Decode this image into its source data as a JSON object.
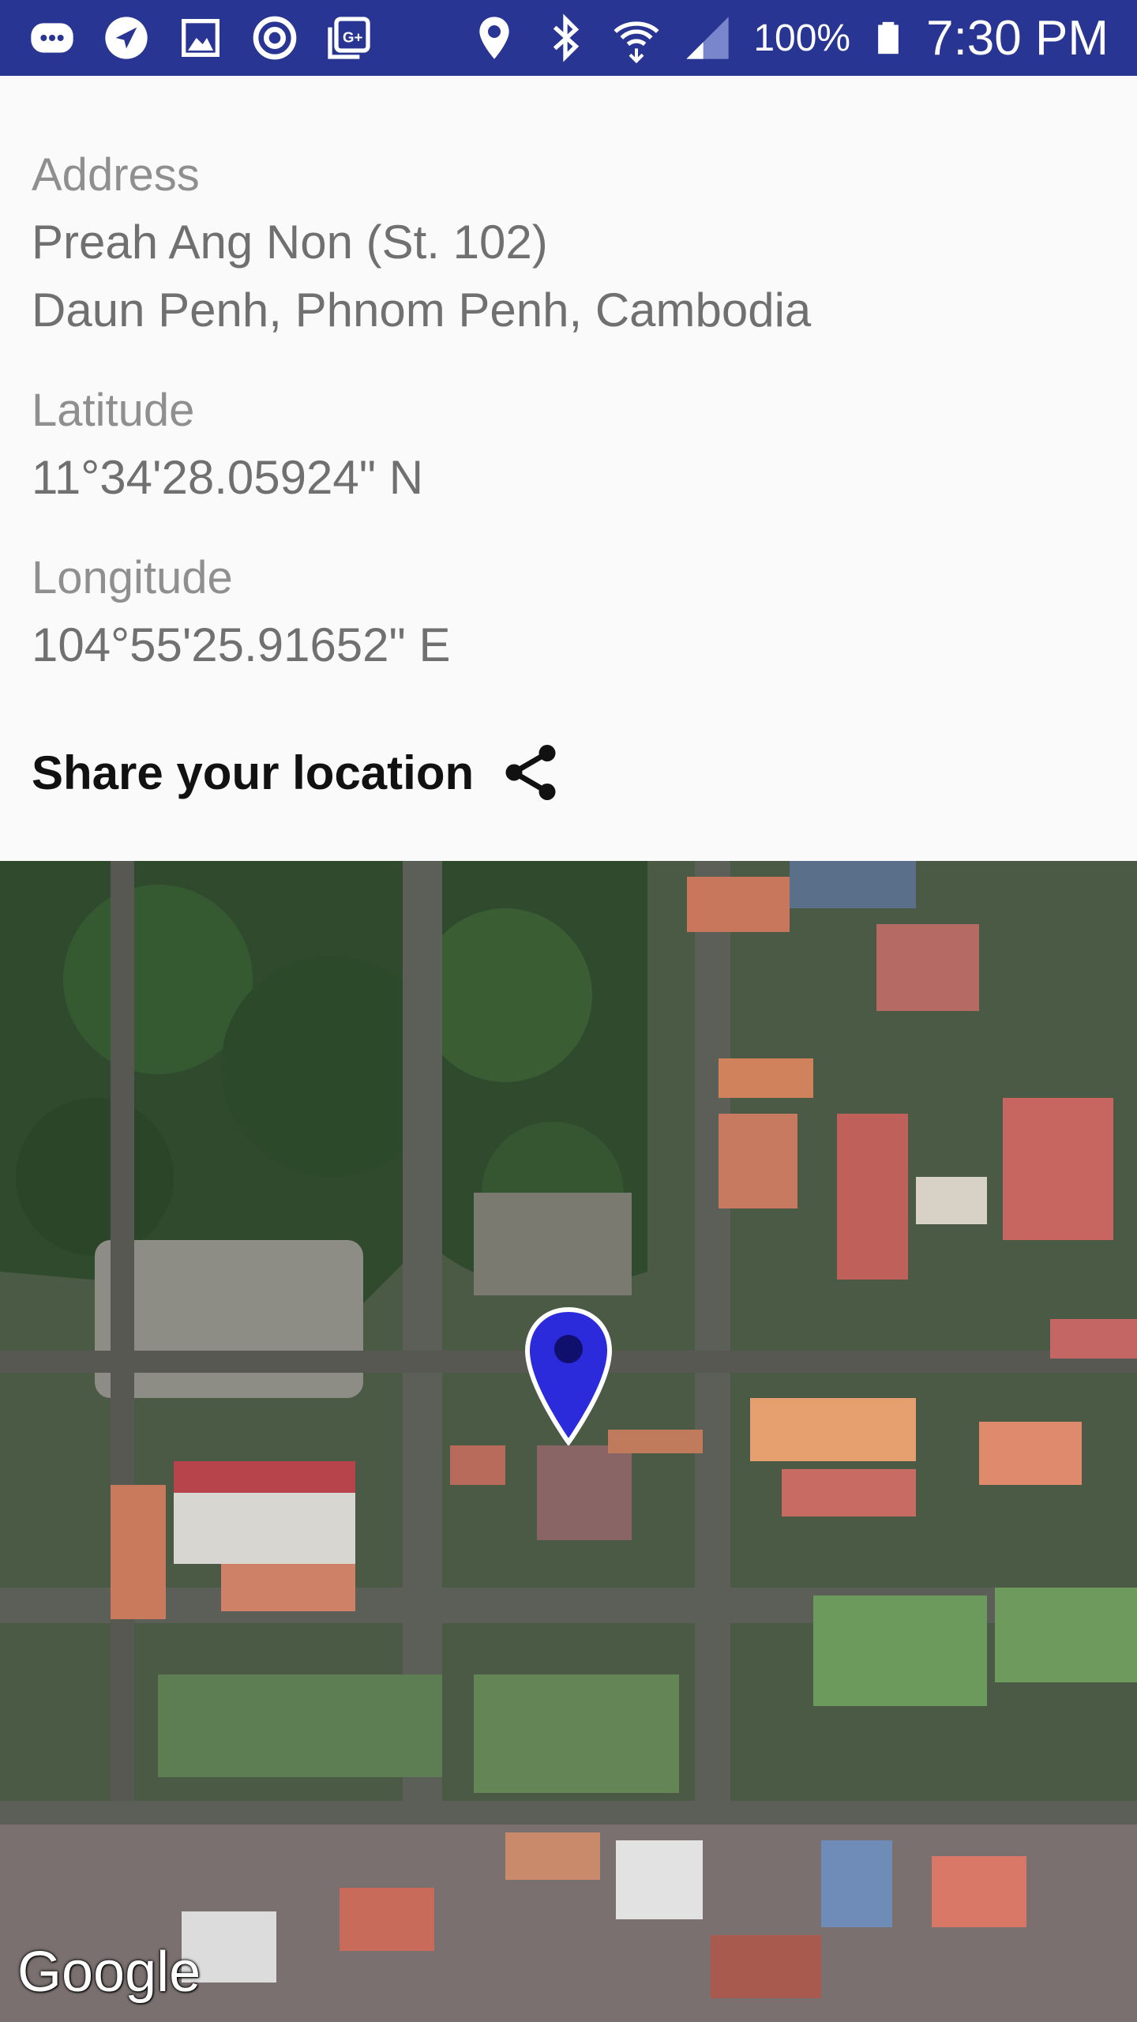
{
  "status_bar": {
    "battery": "100%",
    "time": "7:30 PM",
    "left_icons": [
      "message-icon",
      "navigation-icon",
      "image-icon",
      "sync-icon",
      "google-plus-icon"
    ],
    "right_icons": [
      "location-icon",
      "bluetooth-icon",
      "wifi-icon",
      "signal-icon",
      "battery-icon"
    ]
  },
  "info": {
    "address_label": "Address",
    "address_line1": "Preah Ang Non (St. 102)",
    "address_line2": "Daun Penh, Phnom Penh, Cambodia",
    "latitude_label": "Latitude",
    "latitude_value": "11°34'28.05924\" N",
    "longitude_label": "Longitude",
    "longitude_value": "104°55'25.91652\" E",
    "share_label": "Share your location"
  },
  "map": {
    "attribution": "Google",
    "marker_color": "#2b2bdc"
  }
}
